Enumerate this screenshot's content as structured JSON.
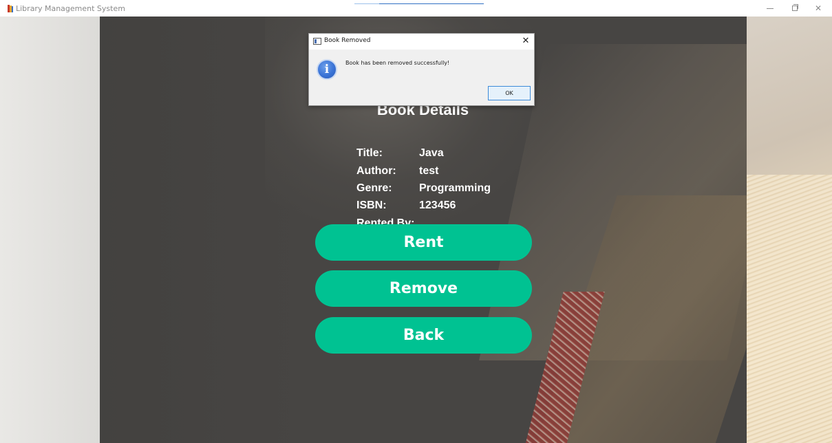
{
  "window": {
    "title": "Library Management System",
    "controls": {
      "minimize_icon": "minimize-icon",
      "maximize_icon": "maximize-icon",
      "close_glyph": "✕"
    }
  },
  "book_details": {
    "heading": "Book Details",
    "fields": [
      {
        "label": "Title:",
        "value": "Java"
      },
      {
        "label": "Author:",
        "value": "test"
      },
      {
        "label": "Genre:",
        "value": "Programming"
      },
      {
        "label": "ISBN:",
        "value": "123456"
      },
      {
        "label": "Rented By:",
        "value": ""
      }
    ]
  },
  "actions": {
    "rent_label": "Rent",
    "remove_label": "Remove",
    "back_label": "Back",
    "button_color": "#00c292"
  },
  "dialog": {
    "title": "Book Removed",
    "message": "Book has been removed successfully!",
    "ok_label": "OK",
    "close_glyph": "✕",
    "icon": "info-icon",
    "icon_glyph": "i"
  }
}
